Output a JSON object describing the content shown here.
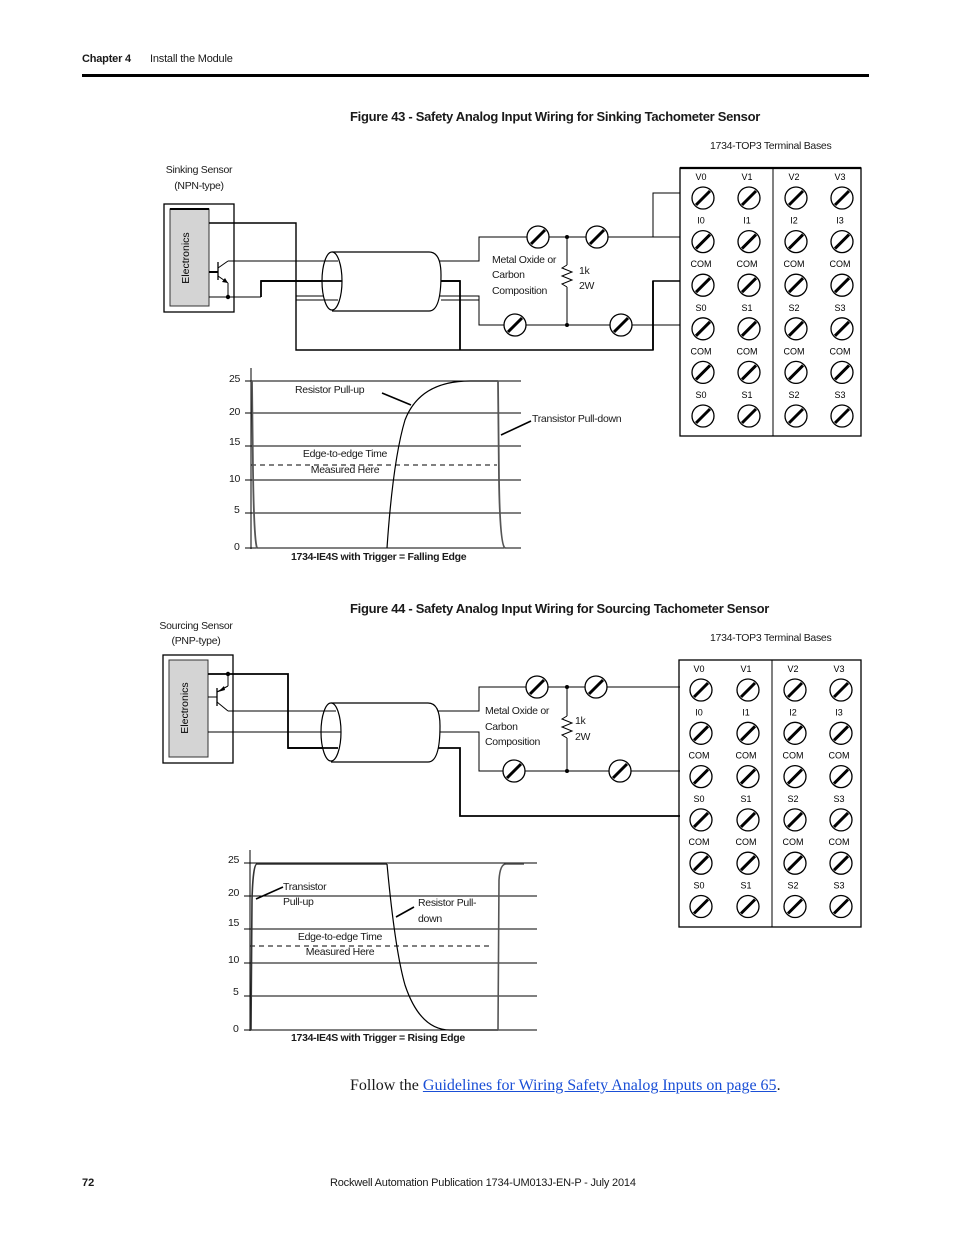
{
  "header": {
    "chapter": "Chapter 4",
    "section": "Install the Module"
  },
  "figures": [
    {
      "title": "Figure 43 - Safety Analog Input Wiring for Sinking Tachometer Sensor",
      "sensor_label_line1": "Sinking Sensor",
      "sensor_label_line2": "(NPN-type)",
      "electronics_label": "Electronics",
      "resistor_note_line1": "Metal Oxide or",
      "resistor_note_line2": "Carbon",
      "resistor_note_line3": "Composition",
      "resistor_value_line1": "1k",
      "resistor_value_line2": "2W",
      "terminal_base_title": "1734-TOP3 Terminal Bases",
      "graph": {
        "y_ticks": [
          "25",
          "20",
          "15",
          "10",
          "5",
          "0"
        ],
        "annotation_1": "Resistor Pull-up",
        "annotation_2": "Transistor Pull-down",
        "measure_line1": "Edge-to-edge Time",
        "measure_line2": "Measured Here",
        "caption": "1734-IE4S with Trigger = Falling Edge"
      }
    },
    {
      "title": "Figure 44 - Safety Analog Input Wiring for Sourcing Tachometer Sensor",
      "sensor_label_line1": "Sourcing Sensor",
      "sensor_label_line2": "(PNP-type)",
      "electronics_label": "Electronics",
      "resistor_note_line1": "Metal Oxide or",
      "resistor_note_line2": "Carbon",
      "resistor_note_line3": "Composition",
      "resistor_value_line1": "1k",
      "resistor_value_line2": "2W",
      "terminal_base_title": "1734-TOP3 Terminal Bases",
      "graph": {
        "y_ticks": [
          "25",
          "20",
          "15",
          "10",
          "5",
          "0"
        ],
        "annotation_1_line1": "Transistor",
        "annotation_1_line2": "Pull-up",
        "annotation_2_line1": "Resistor Pull-",
        "annotation_2_line2": "down",
        "measure_line1": "Edge-to-edge Time",
        "measure_line2": "Measured Here",
        "caption": "1734-IE4S with Trigger = Rising Edge"
      }
    }
  ],
  "terminal_rows": [
    [
      "V0",
      "V1",
      "V2",
      "V3"
    ],
    [
      "I0",
      "I1",
      "I2",
      "I3"
    ],
    [
      "COM",
      "COM",
      "COM",
      "COM"
    ],
    [
      "S0",
      "S1",
      "S2",
      "S3"
    ],
    [
      "COM",
      "COM",
      "COM",
      "COM"
    ],
    [
      "S0",
      "S1",
      "S2",
      "S3"
    ]
  ],
  "body": {
    "follow_prefix": "Follow the ",
    "link_text": "Guidelines for Wiring Safety Analog Inputs on page 65",
    "follow_suffix": "."
  },
  "footer": {
    "page_number": "72",
    "publication": "Rockwell Automation Publication 1734-UM013J-EN-P - July 2014"
  },
  "colors": {
    "link": "#1a4fd6",
    "electronics_fill": "#d4d4d4"
  }
}
